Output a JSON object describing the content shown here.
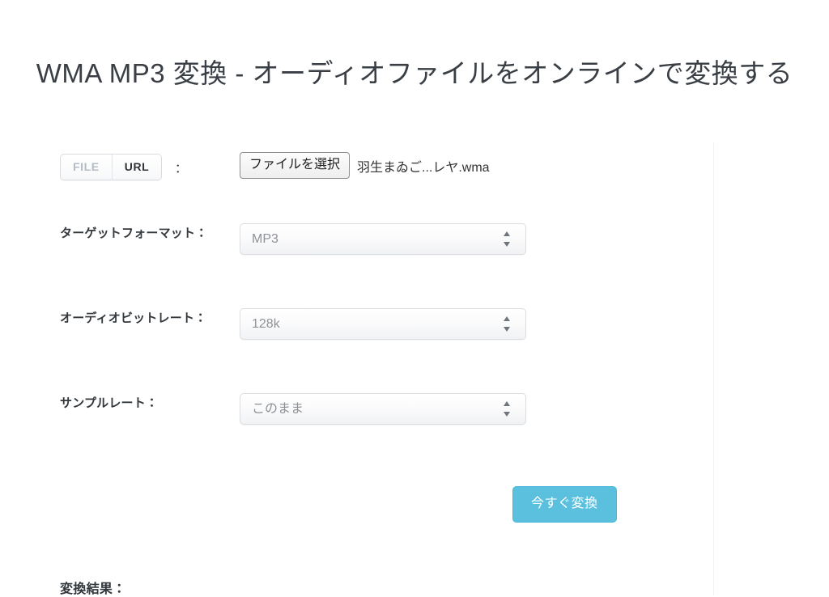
{
  "page": {
    "title": "WMA MP3 変換 - オーディオファイルをオンラインで変換する",
    "background_color": "#ffffff",
    "accent_color": "#5bc0de"
  },
  "source_row": {
    "file_tab_label": "FILE",
    "url_tab_label": "URL",
    "colon": "：",
    "file_button_label": "ファイルを選択",
    "file_name": "羽生まゐご...レヤ.wma"
  },
  "format_row": {
    "label": "ターゲットフォーマット：",
    "value": "MP3",
    "arrow_icon": "stepper-updown-icon"
  },
  "bitrate_row": {
    "label": "オーディオビットレート：",
    "value": "128k",
    "arrow_icon": "stepper-updown-icon"
  },
  "samplerate_row": {
    "label": "サンプルレート：",
    "value": "このまま",
    "arrow_icon": "stepper-updown-icon"
  },
  "submit": {
    "label": "今すぐ変換"
  },
  "result": {
    "heading": "変換結果："
  }
}
